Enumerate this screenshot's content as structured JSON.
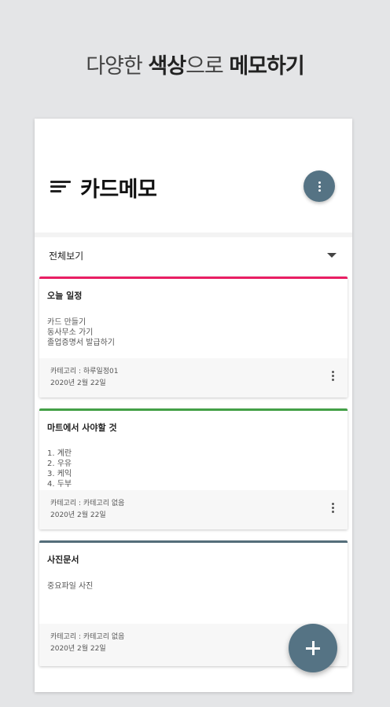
{
  "promo": {
    "light1": "다양한 ",
    "bold1": "색상",
    "light2": "으로 ",
    "bold2": "메모하기"
  },
  "appbar": {
    "title": "카드메모"
  },
  "filter": {
    "selected": "전체보기"
  },
  "colors": {
    "accent": "#557384",
    "pink": "#e91e63",
    "green": "#43a047",
    "slate": "#546e7a"
  },
  "cards": [
    {
      "title": "오늘 일정",
      "lines": [
        "카드 만들기",
        "동사무소 가기",
        "졸업증명서 발급하기"
      ],
      "category": "카테고리 : 하루일정01",
      "date": "2020년 2월 22일"
    },
    {
      "title": "마트에서 사야할 것",
      "lines": [
        "1. 계란",
        "2. 우유",
        "3. 케익",
        "4. 두부"
      ],
      "category": "카테고리 : 카테고리 없음",
      "date": "2020년 2월 22일"
    },
    {
      "title": "사진문서",
      "lines": [
        "중요파일 사진"
      ],
      "category": "카테고리 : 카테고리 없음",
      "date": "2020년 2월 22일"
    }
  ]
}
